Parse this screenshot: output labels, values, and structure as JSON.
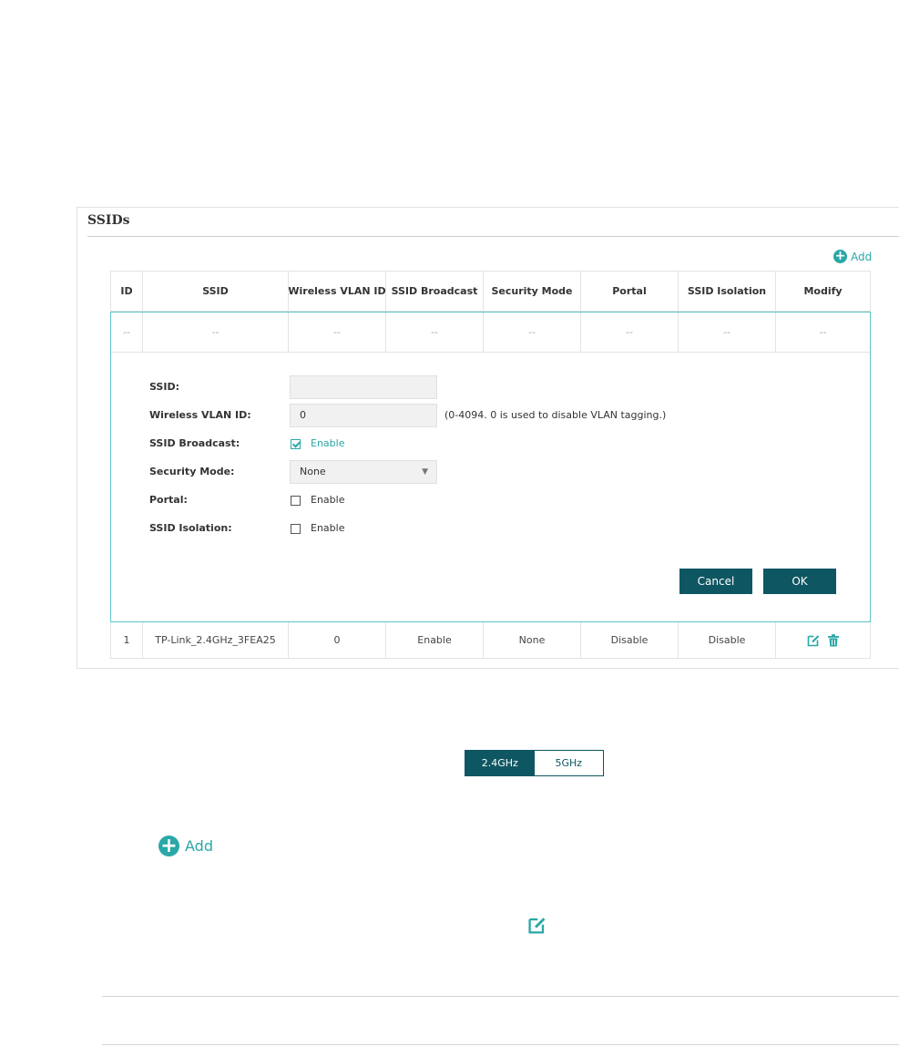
{
  "panel": {
    "title": "SSIDs",
    "add_label": "Add"
  },
  "table": {
    "columns": [
      "ID",
      "SSID",
      "Wireless VLAN ID",
      "SSID Broadcast",
      "Security Mode",
      "Portal",
      "SSID Isolation",
      "Modify"
    ],
    "placeholder_row": [
      "--",
      "--",
      "--",
      "--",
      "--",
      "--",
      "--",
      "--"
    ],
    "rows": [
      {
        "id": "1",
        "ssid": "TP-Link_2.4GHz_3FEA25",
        "vlan_id": "0",
        "broadcast": "Enable",
        "security_mode": "None",
        "portal": "Disable",
        "isolation": "Disable"
      }
    ]
  },
  "form": {
    "ssid_label": "SSID:",
    "ssid_value": "",
    "vlan_label": "Wireless VLAN ID:",
    "vlan_value": "0",
    "vlan_hint": "(0-4094. 0 is used to disable VLAN tagging.)",
    "broadcast_label": "SSID Broadcast:",
    "broadcast_checked": true,
    "broadcast_option": "Enable",
    "security_label": "Security Mode:",
    "security_value": "None",
    "portal_label": "Portal:",
    "portal_checked": false,
    "portal_option": "Enable",
    "isolation_label": "SSID Isolation:",
    "isolation_checked": false,
    "isolation_option": "Enable",
    "cancel_label": "Cancel",
    "ok_label": "OK"
  },
  "band_toggle": {
    "options": [
      "2.4GHz",
      "5GHz"
    ],
    "selected": "2.4GHz"
  },
  "standalone": {
    "add_label": "Add"
  },
  "icons": {
    "add": "plus-circle-icon",
    "edit": "edit-icon",
    "delete": "trash-icon",
    "dropdown": "caret-down-icon",
    "check": "checkmark-icon"
  },
  "colors": {
    "accent": "#2aa7a7",
    "button_dark": "#0e5662",
    "editor_border": "#5cc4c8"
  }
}
